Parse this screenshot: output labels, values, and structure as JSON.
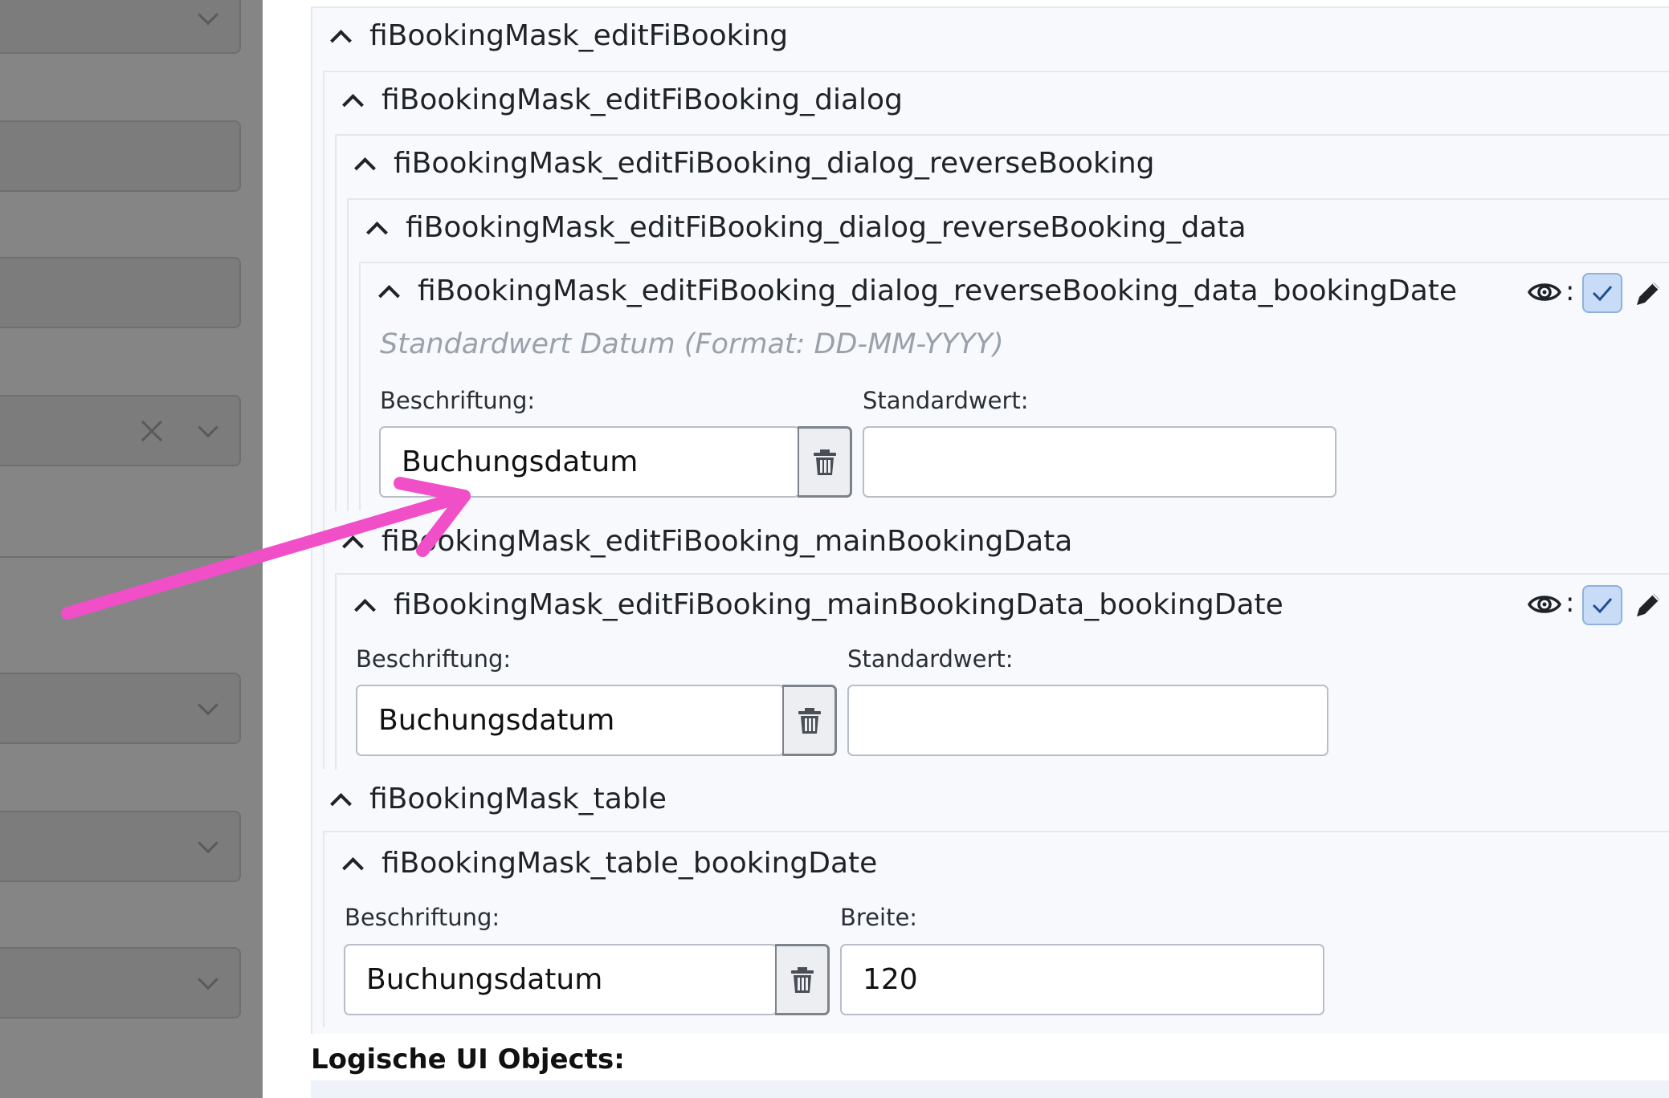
{
  "sections": {
    "editFiBooking": "fiBookingMask_editFiBooking",
    "dialog": "fiBookingMask_editFiBooking_dialog",
    "reverseBooking": "fiBookingMask_editFiBooking_dialog_reverseBooking",
    "reverseBookingData": "fiBookingMask_editFiBooking_dialog_reverseBooking_data",
    "reverseBookingDate": "fiBookingMask_editFiBooking_dialog_reverseBooking_data_bookingDate",
    "mainBookingData": "fiBookingMask_editFiBooking_mainBookingData",
    "mainBookingDate": "fiBookingMask_editFiBooking_mainBookingData_bookingDate",
    "table": "fiBookingMask_table",
    "tableBookingDate": "fiBookingMask_table_bookingDate"
  },
  "reverseBookingDate": {
    "hint": "Standardwert Datum (Format: DD-MM-YYYY)",
    "caption_label": "Beschriftung:",
    "caption_value": "Buchungsdatum",
    "default_label": "Standardwert:",
    "default_value": ""
  },
  "mainBookingDate": {
    "caption_label": "Beschriftung:",
    "caption_value": "Buchungsdatum",
    "default_label": "Standardwert:",
    "default_value": ""
  },
  "tableBookingDate": {
    "caption_label": "Beschriftung:",
    "caption_value": "Buchungsdatum",
    "width_label": "Breite:",
    "width_value": "120"
  },
  "footer": {
    "title": "Logische UI Objects:"
  },
  "colors": {
    "annotation_arrow": "#f04fc8",
    "sidebar_overlay": "#858585",
    "checkbox_fill": "#c9dcf7"
  },
  "icons": [
    "chevron-up-icon",
    "eye-icon",
    "checkbox-checked-icon",
    "pencil-icon",
    "trash-icon",
    "chevron-down-icon",
    "clear-x-icon"
  ]
}
